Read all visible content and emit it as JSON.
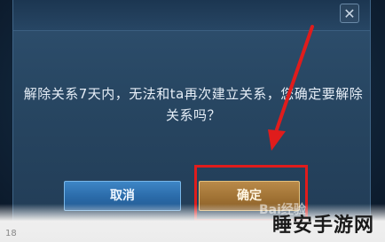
{
  "dialog": {
    "message": "解除关系7天内，无法和ta再次建立关系，您确定要解除关系吗？",
    "close_icon": "close-icon",
    "cancel_label": "取消",
    "confirm_label": "确定"
  },
  "annotation": {
    "highlight_color": "#e01c1c",
    "arrow_color": "#e01c1c"
  },
  "watermark": {
    "site_name": "睡安手游网",
    "baidu_text": "Bai经验",
    "corner_text": "18"
  }
}
